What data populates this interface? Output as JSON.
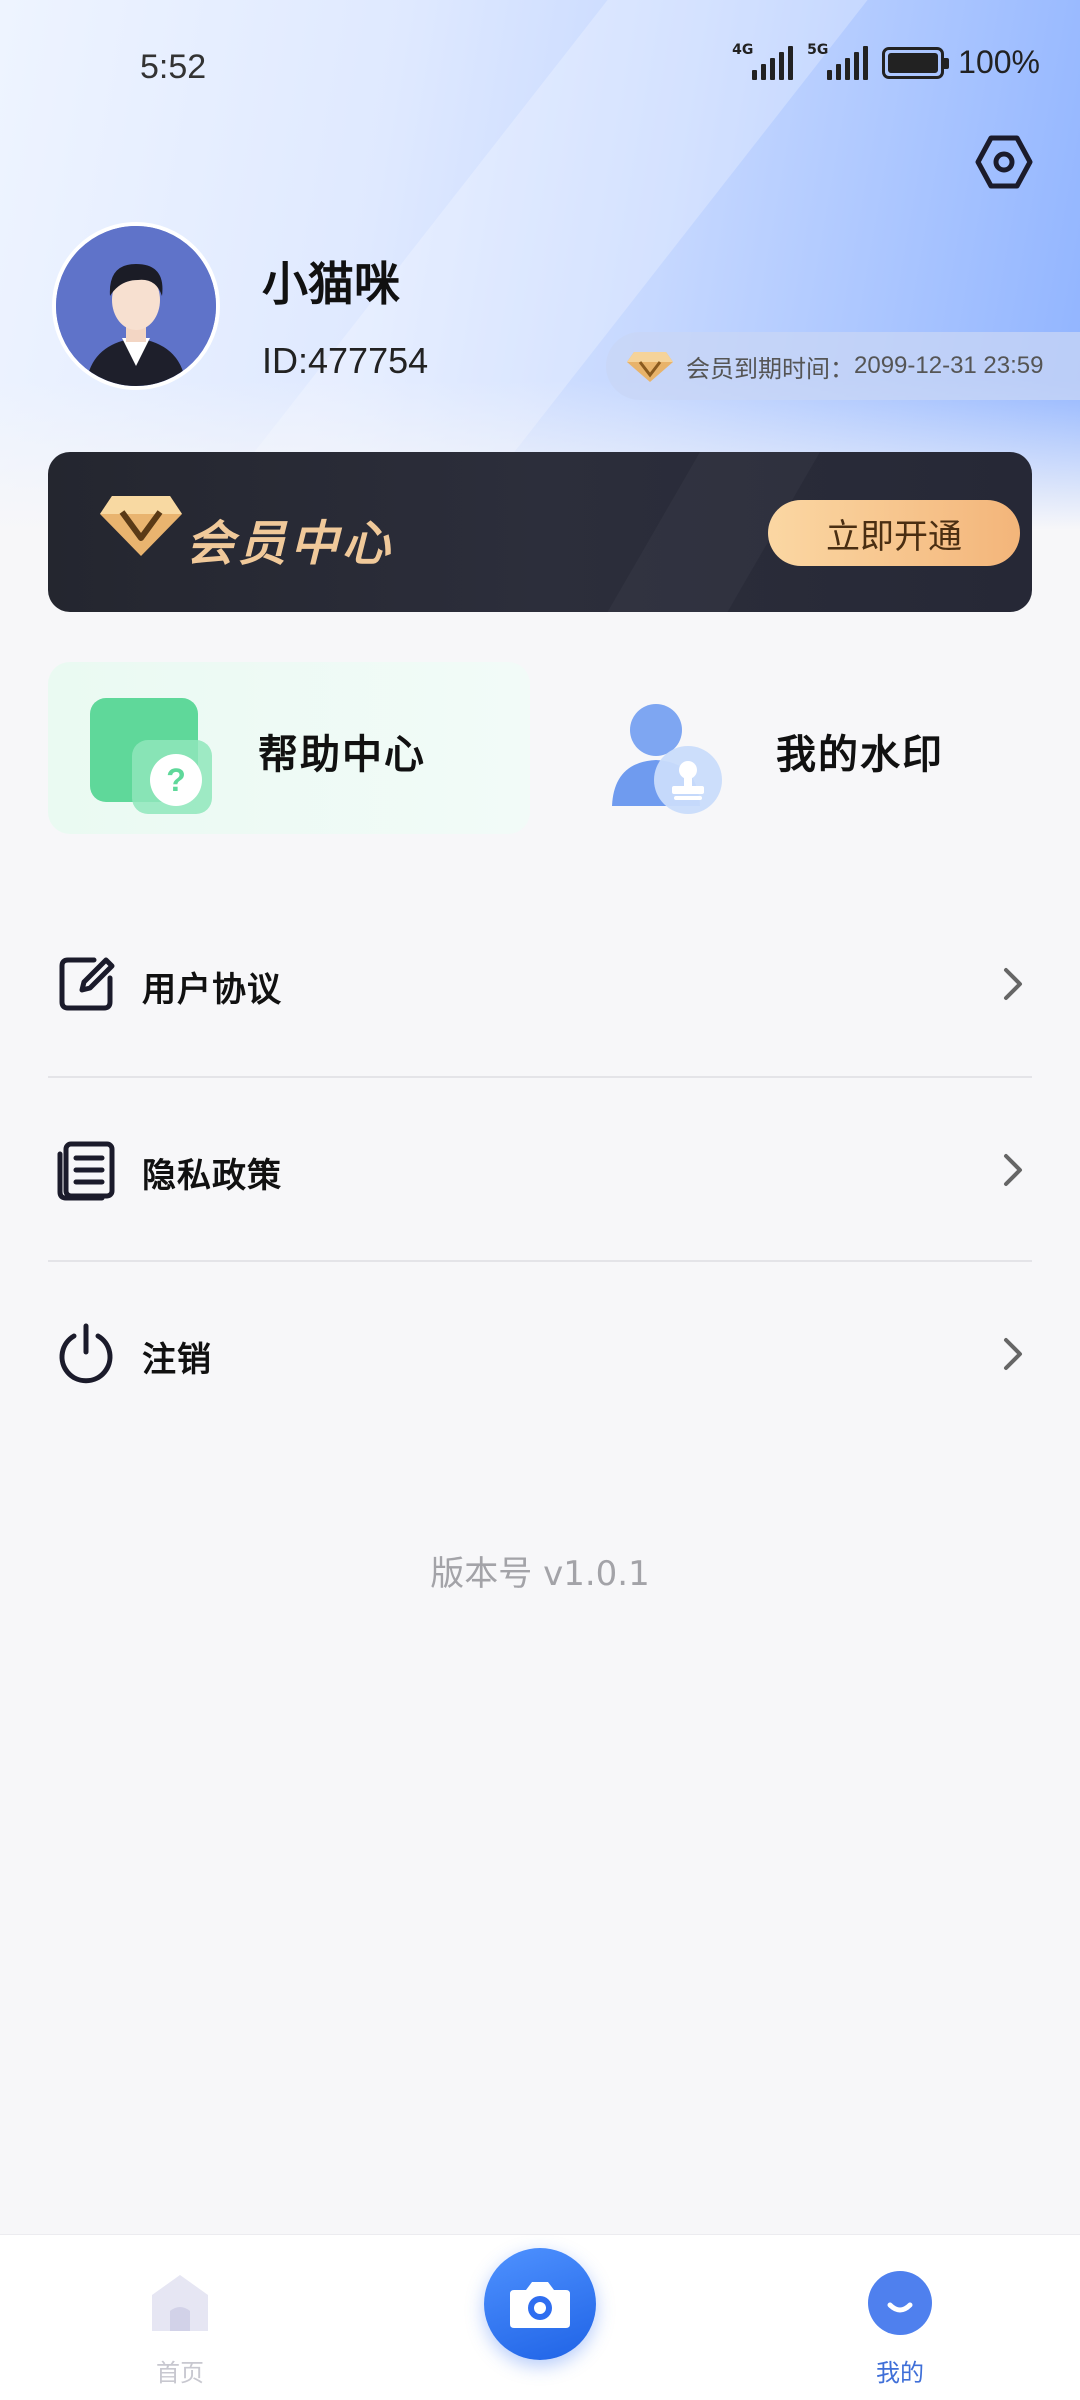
{
  "status_bar": {
    "time": "5:52",
    "network1": "4G",
    "network2": "5G",
    "battery": "100%"
  },
  "profile": {
    "username": "小猫咪",
    "user_id": "ID:477754",
    "vip_expiry_label": "会员到期时间：",
    "vip_expiry_value": "2099-12-31 23:59"
  },
  "member_banner": {
    "title": "会员中心",
    "button_label": "立即开通"
  },
  "quick_actions": [
    {
      "label": "帮助中心",
      "icon": "help-icon"
    },
    {
      "label": "我的水印",
      "icon": "watermark-icon"
    }
  ],
  "menu": [
    {
      "label": "用户协议",
      "icon": "edit-icon"
    },
    {
      "label": "隐私政策",
      "icon": "document-icon"
    },
    {
      "label": "注销",
      "icon": "power-icon"
    }
  ],
  "version": "版本号 v1.0.1",
  "tab_bar": {
    "tabs": [
      {
        "label": "首页",
        "icon": "home-icon",
        "active": false
      },
      {
        "label": "我的",
        "icon": "profile-icon",
        "active": true
      }
    ],
    "center_button_icon": "camera-icon"
  },
  "colors": {
    "accent": "#3f6fd8",
    "banner_bg": "#262836",
    "gold": "#f0c99a",
    "help_card_bg": "#eafaf2"
  }
}
